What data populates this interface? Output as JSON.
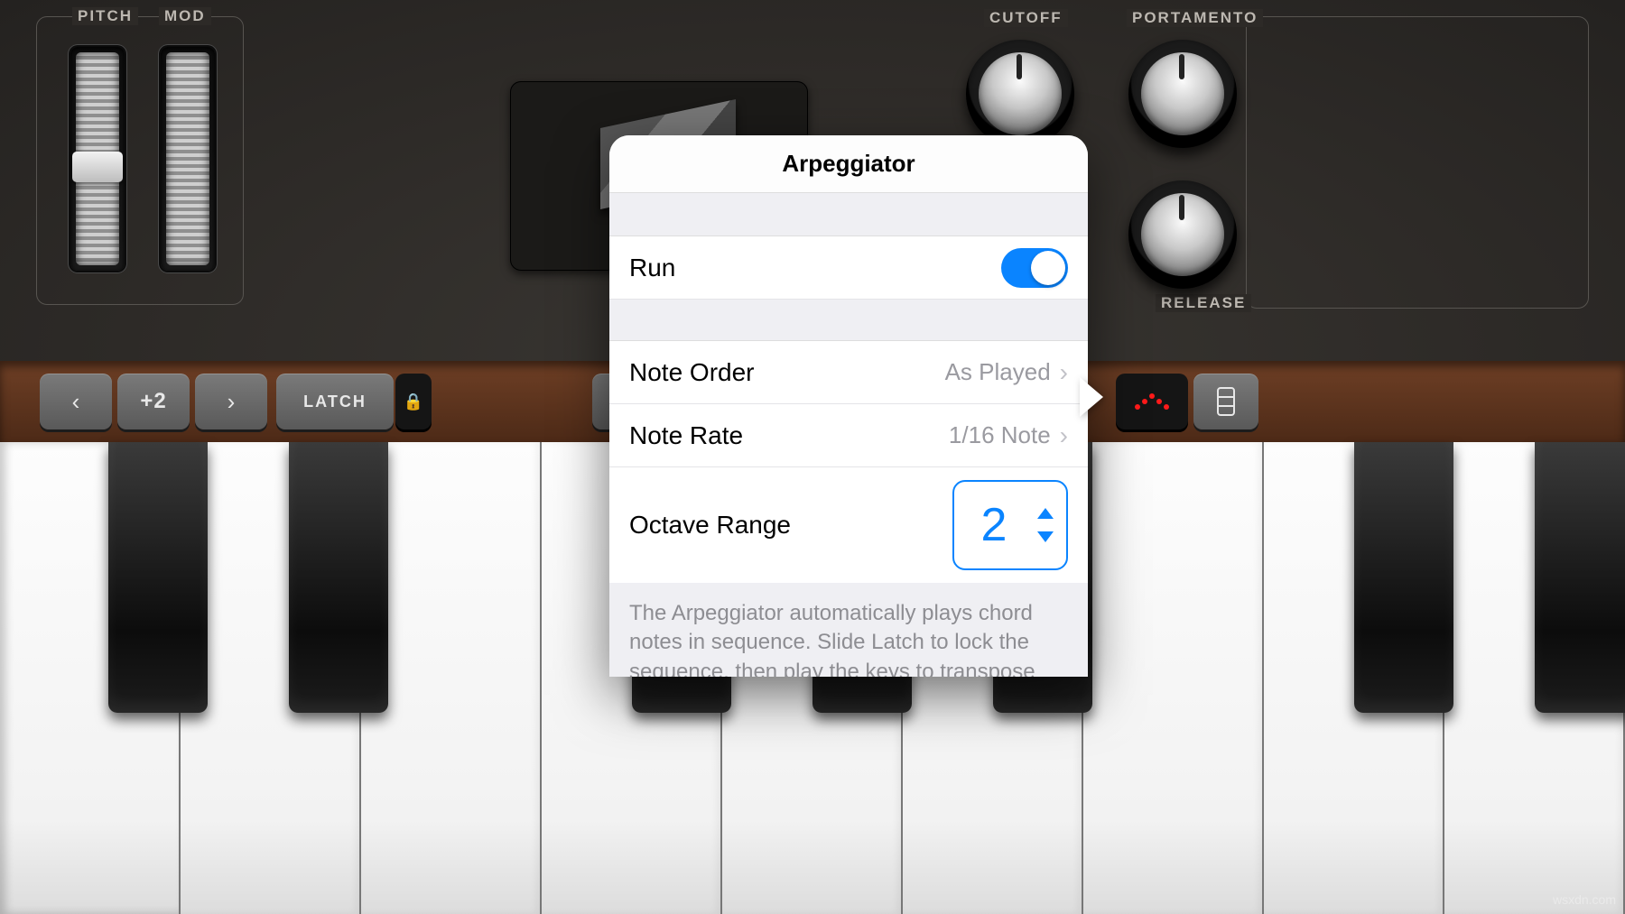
{
  "controls": {
    "pitch_label": "PITCH",
    "mod_label": "MOD",
    "cutoff_label": "CUTOFF",
    "portamento_label": "PORTAMENTO",
    "release_label": "RELEASE"
  },
  "toolbar": {
    "octave_offset": "+2",
    "latch_label": "LATCH"
  },
  "popup": {
    "title": "Arpeggiator",
    "run_label": "Run",
    "run_enabled": true,
    "note_order_label": "Note Order",
    "note_order_value": "As Played",
    "note_rate_label": "Note Rate",
    "note_rate_value": "1/16 Note",
    "octave_range_label": "Octave Range",
    "octave_range_value": "2",
    "description": "The Arpeggiator automatically plays chord notes in sequence. Slide Latch to lock the sequence, then play the keys to transpose the sequence."
  },
  "watermark": "wsxdn.com"
}
